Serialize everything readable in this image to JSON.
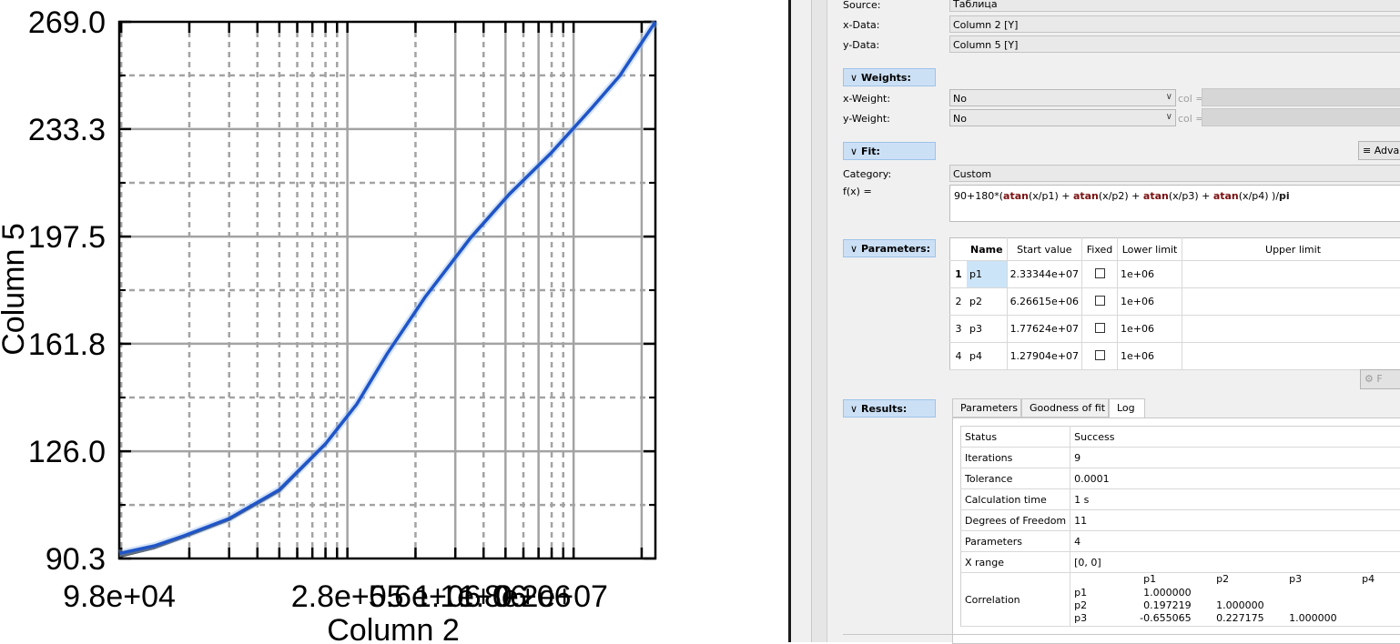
{
  "chart_data": {
    "type": "line",
    "xlabel": "Column 2",
    "ylabel": "Column 5",
    "x_scale": "log",
    "xlim": [
      98000,
      23000000
    ],
    "ylim": [
      90.3,
      269.0
    ],
    "x_tick_labels": [
      "9.8e+04",
      "2.8e+05",
      "5.6e+06",
      "1.1e+06",
      "1.8e+06",
      "0.2e+07"
    ],
    "y_tick_labels": [
      "269.0",
      "233.3",
      "197.5",
      "161.8",
      "126.0",
      "90.3"
    ],
    "grid": true,
    "series": [
      {
        "color": "#2a2a2a",
        "x": [
          98000,
          140000,
          190000,
          300000,
          500000,
          800000,
          1100000,
          1500000,
          2200000,
          3500000,
          5200000,
          8000000,
          12000000,
          16000000,
          23000000
        ],
        "y": [
          91.0,
          93.8,
          97.5,
          103.2,
          112.8,
          128.3,
          141.6,
          158.5,
          177.3,
          197.2,
          211.8,
          225.6,
          240.2,
          251.0,
          269.0
        ]
      },
      {
        "color": "#1f55c8",
        "x": [
          98000,
          140000,
          190000,
          300000,
          500000,
          800000,
          1100000,
          1500000,
          2200000,
          3500000,
          5200000,
          8000000,
          12000000,
          16000000,
          23000000
        ],
        "y": [
          92.0,
          94.5,
          97.9,
          103.6,
          113.2,
          128.5,
          141.7,
          158.5,
          177.2,
          197.0,
          211.6,
          225.5,
          240.2,
          251.0,
          269.0
        ]
      }
    ]
  },
  "panel": {
    "source_label": "Source:",
    "source_value": "Таблица",
    "xdata_label": "x-Data:",
    "xdata_value": "Column 2 [Y]",
    "ydata_label": "y-Data:",
    "ydata_value": "Column 5 [Y]",
    "weights_header": "Weights:",
    "xweight_label": "x-Weight:",
    "xweight_value": "No",
    "yweight_label": "y-Weight:",
    "yweight_value": "No",
    "col_label": "col =",
    "fit_header": "Fit:",
    "advanced_label": "Adva",
    "category_label": "Category:",
    "category_value": "Custom",
    "fx_label": "f(x) =",
    "formula": "90+180*(atan(x/p1) + atan(x/p2)  + atan(x/p3) + atan(x/p4) )/pi",
    "parameters_header": "Parameters:",
    "params_headers": [
      "Name",
      "Start value",
      "Fixed",
      "Lower limit",
      "Upper limit"
    ],
    "params": [
      {
        "row": "1",
        "name": "p1",
        "start": "2.33344e+07",
        "lower": "1e+06"
      },
      {
        "row": "2",
        "name": "p2",
        "start": "6.26615e+06",
        "lower": "1e+06"
      },
      {
        "row": "3",
        "name": "p3",
        "start": "1.77624e+07",
        "lower": "1e+06"
      },
      {
        "row": "4",
        "name": "p4",
        "start": "1.27904e+07",
        "lower": "1e+06"
      }
    ],
    "fit_button_label": "F",
    "results_header": "Results:",
    "result_tabs": [
      "Parameters",
      "Goodness of fit",
      "Log"
    ],
    "results": [
      {
        "key": "Status",
        "value": "Success"
      },
      {
        "key": "Iterations",
        "value": "9"
      },
      {
        "key": "Tolerance",
        "value": "0.0001"
      },
      {
        "key": "Calculation time",
        "value": "1 s"
      },
      {
        "key": "Degrees of Freedom",
        "value": "11"
      },
      {
        "key": "Parameters",
        "value": "4"
      },
      {
        "key": "X range",
        "value": "[0, 0]"
      },
      {
        "key": "Correlation",
        "value": ""
      }
    ],
    "correlation": {
      "cols": [
        "p1",
        "p2",
        "p3",
        "p4"
      ],
      "rows": [
        {
          "name": "p1",
          "values": [
            "1.000000"
          ]
        },
        {
          "name": "p2",
          "values": [
            "0.197219",
            "1.000000"
          ]
        },
        {
          "name": "p3",
          "values": [
            "-0.655065",
            "0.227175",
            "1.000000"
          ]
        }
      ]
    }
  }
}
